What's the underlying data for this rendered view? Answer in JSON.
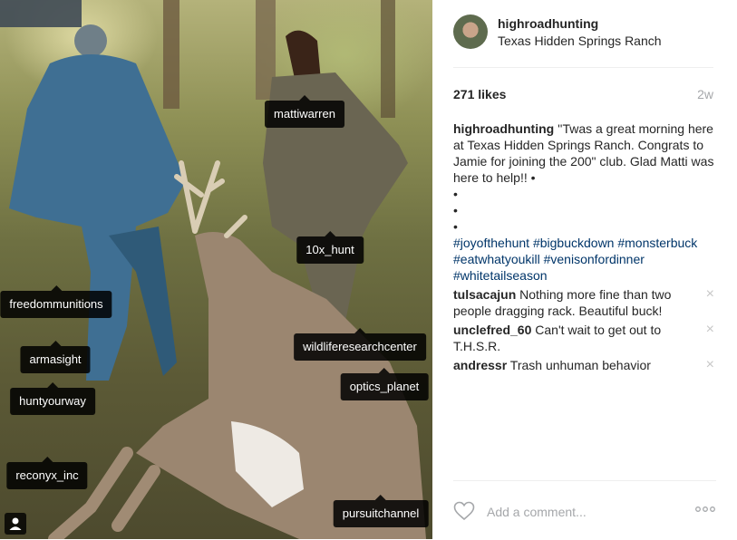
{
  "post": {
    "username": "highroadhunting",
    "location": "Texas Hidden Springs Ranch",
    "likes": "271 likes",
    "time": "2w"
  },
  "caption": {
    "username": "highroadhunting",
    "text": "''Twas a great morning here at Texas Hidden Springs Ranch. Congrats to Jamie for joining the 200\" club. Glad Matti was here to help!! •",
    "bullets": [
      "•",
      "•",
      "•"
    ],
    "hashtags": "#joyofthehunt #bigbuckdown #monsterbuck #eatwhatyoukill #venisonfordinner #whitetailseason"
  },
  "comments": [
    {
      "user": "tulsacajun",
      "text": "Nothing more fine than two people dragging rack. Beautiful buck!"
    },
    {
      "user": "unclefred_60",
      "text": "Can't wait to get out to T.H.S.R."
    },
    {
      "user": "andressr",
      "text": "Trash unhuman behavior"
    }
  ],
  "remove_glyph": "×",
  "tags": [
    {
      "label": "mattiwarren"
    },
    {
      "label": "10x_hunt"
    },
    {
      "label": "freedommunitions"
    },
    {
      "label": "wildliferesearchcenter"
    },
    {
      "label": "armasight"
    },
    {
      "label": "optics_planet"
    },
    {
      "label": "huntyourway"
    },
    {
      "label": "reconyx_inc"
    },
    {
      "label": "pursuitchannel"
    }
  ],
  "add_comment": {
    "placeholder": "Add a comment..."
  },
  "icons": {
    "like": "heart-icon",
    "more": "more-options-icon",
    "user_tags": "person-icon",
    "remove": "close-icon"
  },
  "colors": {
    "hashtag": "#003569",
    "muted": "#a5a7aa",
    "text": "#262626"
  }
}
